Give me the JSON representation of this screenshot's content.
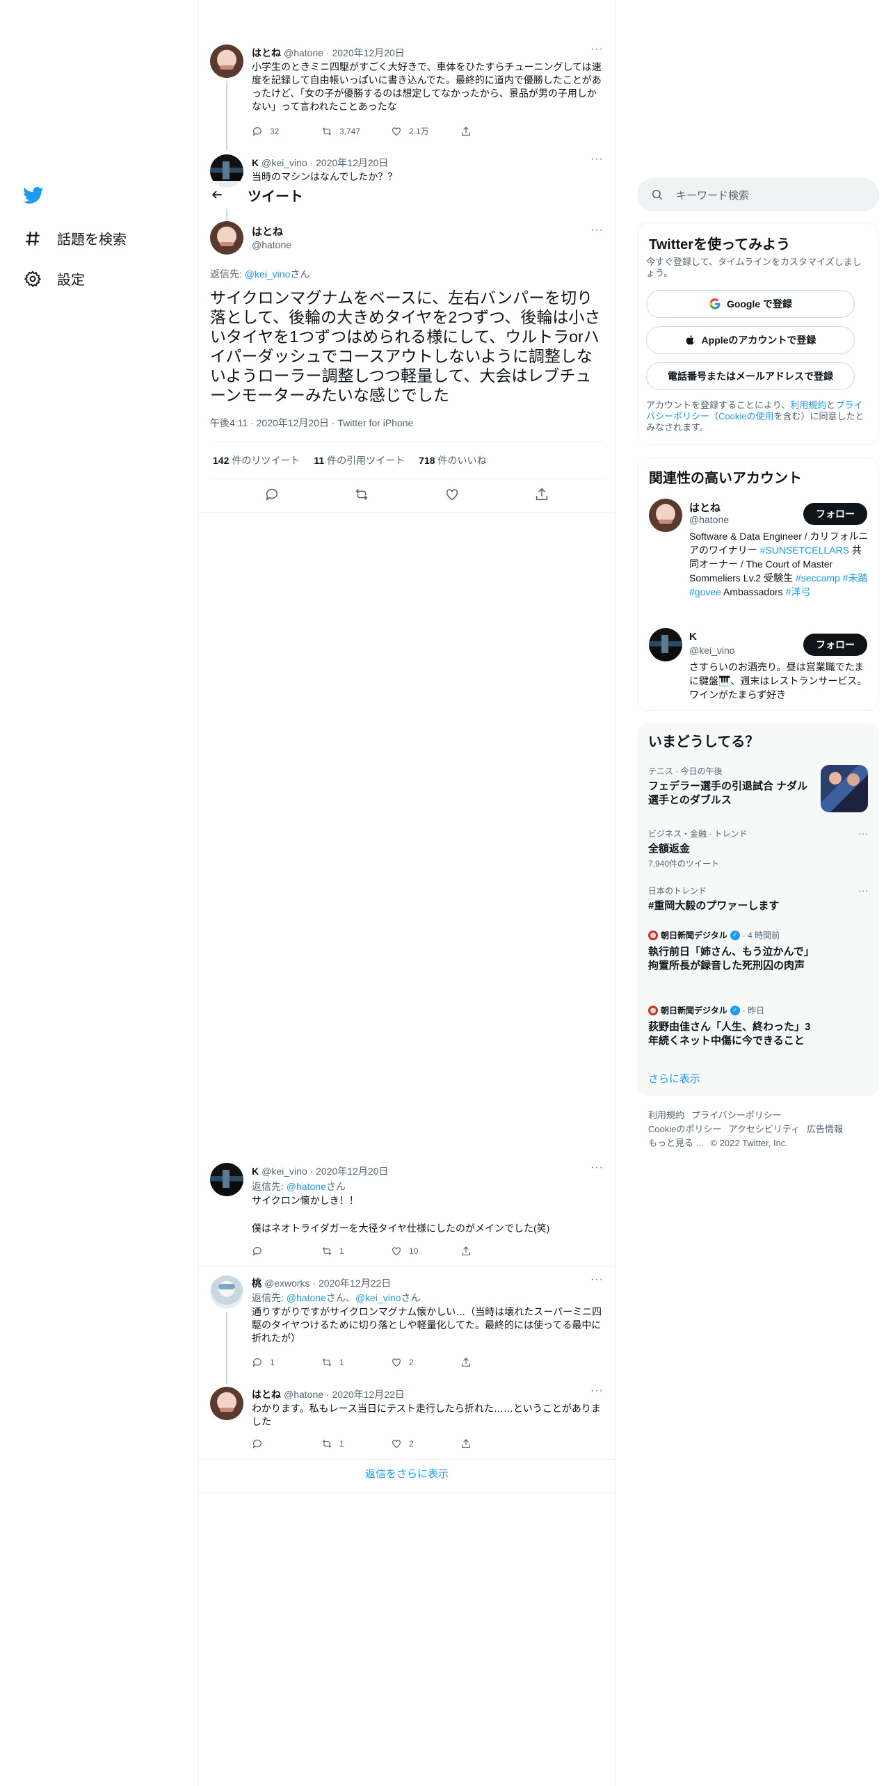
{
  "nav": {
    "explore": "話題を検索",
    "settings": "設定"
  },
  "header": {
    "title": "ツイート"
  },
  "prev_tweet": {
    "name": "はとね",
    "meta": "@hatone · 2020年12月20日",
    "text": "小学生のときミニ四駆がすごく大好きで、車体をひたすらチューニングしては速度を記録して自由帳いっぱいに書き込んでた。最終的に道内で優勝したことがあったけど、「女の子が優勝するのは想定してなかったから、景品が男の子用しかない」って言われたことあったな",
    "replies": "32",
    "retweets": "3,747",
    "likes": "2.1万"
  },
  "prev_tweet2": {
    "name": "K",
    "meta": "@kei_vino · 2020年12月20日",
    "text": "当時のマシンはなんでしたか？？"
  },
  "focus": {
    "name": "はとね",
    "handle": "@hatone",
    "reply_prefix": "返信先: ",
    "reply_to": "@kei_vino",
    "reply_suffix": "さん",
    "text": "サイクロンマグナムをベースに、左右バンパーを切り落として、後輪の大きめタイヤを2つずつ、後輪は小さいタイヤを1つずつはめられる様にして、ウルトラorハイパーダッシュでコースアウトしないように調整しないようローラー調整しつつ軽量して、大会はレブチューンモーターみたいな感じでした",
    "meta": "午後4:11 · 2020年12月20日 · Twitter for iPhone",
    "retweets_n": "142",
    "retweets_l": "件のリツイート",
    "quotes_n": "11",
    "quotes_l": "件の引用ツイート",
    "likes_n": "718",
    "likes_l": "件のいいね"
  },
  "replies": [
    {
      "name": "K",
      "meta": "@kei_vino · 2020年12月20日",
      "reply_prefix": "返信先: ",
      "reply_to": "@hatone",
      "reply_suffix": "さん",
      "line1": "サイクロン懐かしき！！",
      "line2": "僕はネオトライダガーを大径タイヤ仕様にしたのがメインでした(笑)",
      "replies": "",
      "retweets": "1",
      "likes": "10"
    },
    {
      "name": "桃",
      "meta": "@exworks · 2020年12月22日",
      "reply_prefix": "返信先: ",
      "reply_to": "@hatone",
      "reply_mid": "さん、",
      "reply_to2": "@kei_vino",
      "reply_suffix": "さん",
      "text": "通りすがりですがサイクロンマグナム懐かしい…（当時は壊れたスーパーミニ四駆のタイヤつけるために切り落としや軽量化してた。最終的には使ってる最中に折れたが）",
      "replies": "1",
      "retweets": "1",
      "likes": "2"
    },
    {
      "name": "はとね",
      "meta": "@hatone · 2020年12月22日",
      "text": "わかります。私もレース当日にテスト走行したら折れた……ということがありました",
      "replies": "",
      "retweets": "1",
      "likes": "2"
    }
  ],
  "show_more_replies": "返信をさらに表示",
  "search": {
    "placeholder": "キーワード検索"
  },
  "signup": {
    "title": "Twitterを使ってみよう",
    "subtitle": "今すぐ登録して、タイムラインをカスタマイズしましょう。",
    "google": "Google で登録",
    "apple": "Appleのアカウントで登録",
    "phone": "電話番号またはメールアドレスで登録",
    "legal_1": "アカウントを登録することにより、",
    "legal_terms": "利用規約",
    "legal_2": "と",
    "legal_privacy": "プライバシーポリシー",
    "legal_3": "（",
    "legal_cookie": "Cookieの使用",
    "legal_4": "を含む）に同意したとみなされます。"
  },
  "related": {
    "title": "関連性の高いアカウント",
    "follow_label": "フォロー",
    "accounts": [
      {
        "name": "はとね",
        "handle": "@hatone",
        "bio_1": "Software & Data Engineer / カリフォルニアのワイナリー ",
        "bio_tag1": "#SUNSETCELLARS",
        "bio_2": " 共同オーナー / The Court of Master Sommeliers Lv.2 受験生 ",
        "bio_tag2": "#seccamp",
        "bio_tag3": "#未踏",
        "bio_tag4": "#govee",
        "bio_3": " Ambassadors ",
        "bio_tag5": "#洋弓"
      },
      {
        "name": "K",
        "handle": "@kei_vino",
        "bio": "さすらいのお酒売り。昼は営業職でたまに鍵盤🎹、週末はレストランサービス。 ワインがたまらず好き"
      }
    ]
  },
  "trends": {
    "title": "いまどうしてる？",
    "items": [
      {
        "meta": "テニス · 今日の午後",
        "title": "フェデラー選手の引退試合 ナダル選手とのダブルス"
      },
      {
        "meta": "ビジネス・金融 · トレンド",
        "title": "全額返金",
        "count": "7,940件のツイート"
      },
      {
        "meta": "日本のトレンド",
        "title": "#重岡大毅のプワァーします"
      },
      {
        "source": "朝日新聞デジタル",
        "time": "· 4 時間前",
        "title": "執行前日「姉さん、もう泣かんで」　拘置所長が録音した死刑囚の肉声"
      },
      {
        "source": "朝日新聞デジタル",
        "time": "· 昨日",
        "title": "荻野由佳さん「人生、終わった」3年続くネット中傷に今できること"
      }
    ],
    "show_more": "さらに表示"
  },
  "footer": {
    "terms": "利用規約",
    "privacy": "プライバシーポリシー",
    "cookie": "Cookieのポリシー",
    "accessibility": "アクセシビリティ",
    "ads": "広告情報",
    "more": "もっと見る ...",
    "copyright": "© 2022 Twitter, Inc."
  },
  "colors": {
    "accent": "#1d9bf0",
    "text": "#0f1419",
    "muted": "#536471",
    "border": "#eff3f4"
  },
  "icons": [
    "twitter-bird-icon",
    "hashtag-icon",
    "gear-icon",
    "back-arrow-icon",
    "search-icon",
    "reply-icon",
    "retweet-icon",
    "like-icon",
    "share-icon",
    "more-dots-icon",
    "google-icon",
    "apple-icon",
    "verified-icon"
  ]
}
